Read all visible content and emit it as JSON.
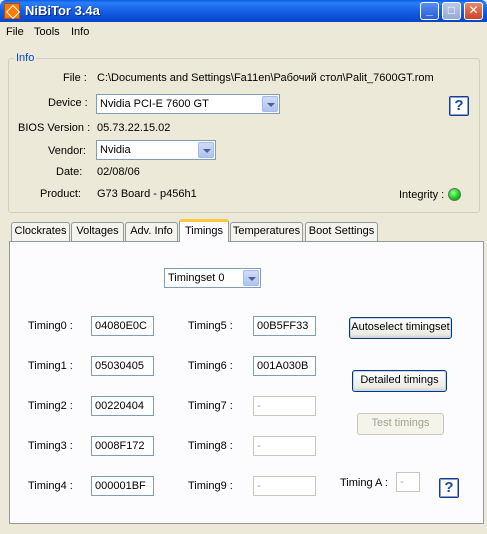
{
  "window": {
    "title": "NiBiTor 3.4a",
    "min_glyph": "_",
    "max_glyph": "□",
    "close_glyph": "✕"
  },
  "menu": {
    "file": "File",
    "tools": "Tools",
    "info": "Info"
  },
  "info": {
    "legend": "Info",
    "file_label": "File :",
    "file_value": "C:\\Documents and Settings\\Fa11en\\Рабочий стол\\Palit_7600GT.rom",
    "device_label": "Device :",
    "device_value": "Nvidia PCI-E 7600 GT",
    "bios_label": "BIOS Version :",
    "bios_value": "05.73.22.15.02",
    "vendor_label": "Vendor:",
    "vendor_value": "Nvidia",
    "date_label": "Date:",
    "date_value": "02/08/06",
    "product_label": "Product:",
    "product_value": "G73 Board - p456h1",
    "integrity_label": "Integrity :",
    "integrity_color": "#14d214",
    "help_glyph": "?"
  },
  "tabs": [
    "Clockrates",
    "Voltages",
    "Adv. Info",
    "Timings",
    "Temperatures",
    "Boot Settings"
  ],
  "active_tab": "Timings",
  "timings": {
    "timingset_value": "Timingset 0",
    "rows_left": [
      {
        "label": "Timing0 :",
        "value": "04080E0C"
      },
      {
        "label": "Timing1 :",
        "value": "05030405"
      },
      {
        "label": "Timing2 :",
        "value": "00220404"
      },
      {
        "label": "Timing3 :",
        "value": "0008F172"
      },
      {
        "label": "Timing4 :",
        "value": "000001BF"
      }
    ],
    "rows_right": [
      {
        "label": "Timing5 :",
        "value": "00B5FF33"
      },
      {
        "label": "Timing6 :",
        "value": "001A030B"
      },
      {
        "label": "Timing7 :",
        "value": "-"
      },
      {
        "label": "Timing8 :",
        "value": "-"
      },
      {
        "label": "Timing9 :",
        "value": "-"
      }
    ],
    "autoselect_label": "Autoselect timingset",
    "detailed_label": "Detailed timings",
    "test_label": "Test timings",
    "timing_a_label": "Timing A :",
    "timing_a_value": "-",
    "help_glyph": "?"
  }
}
